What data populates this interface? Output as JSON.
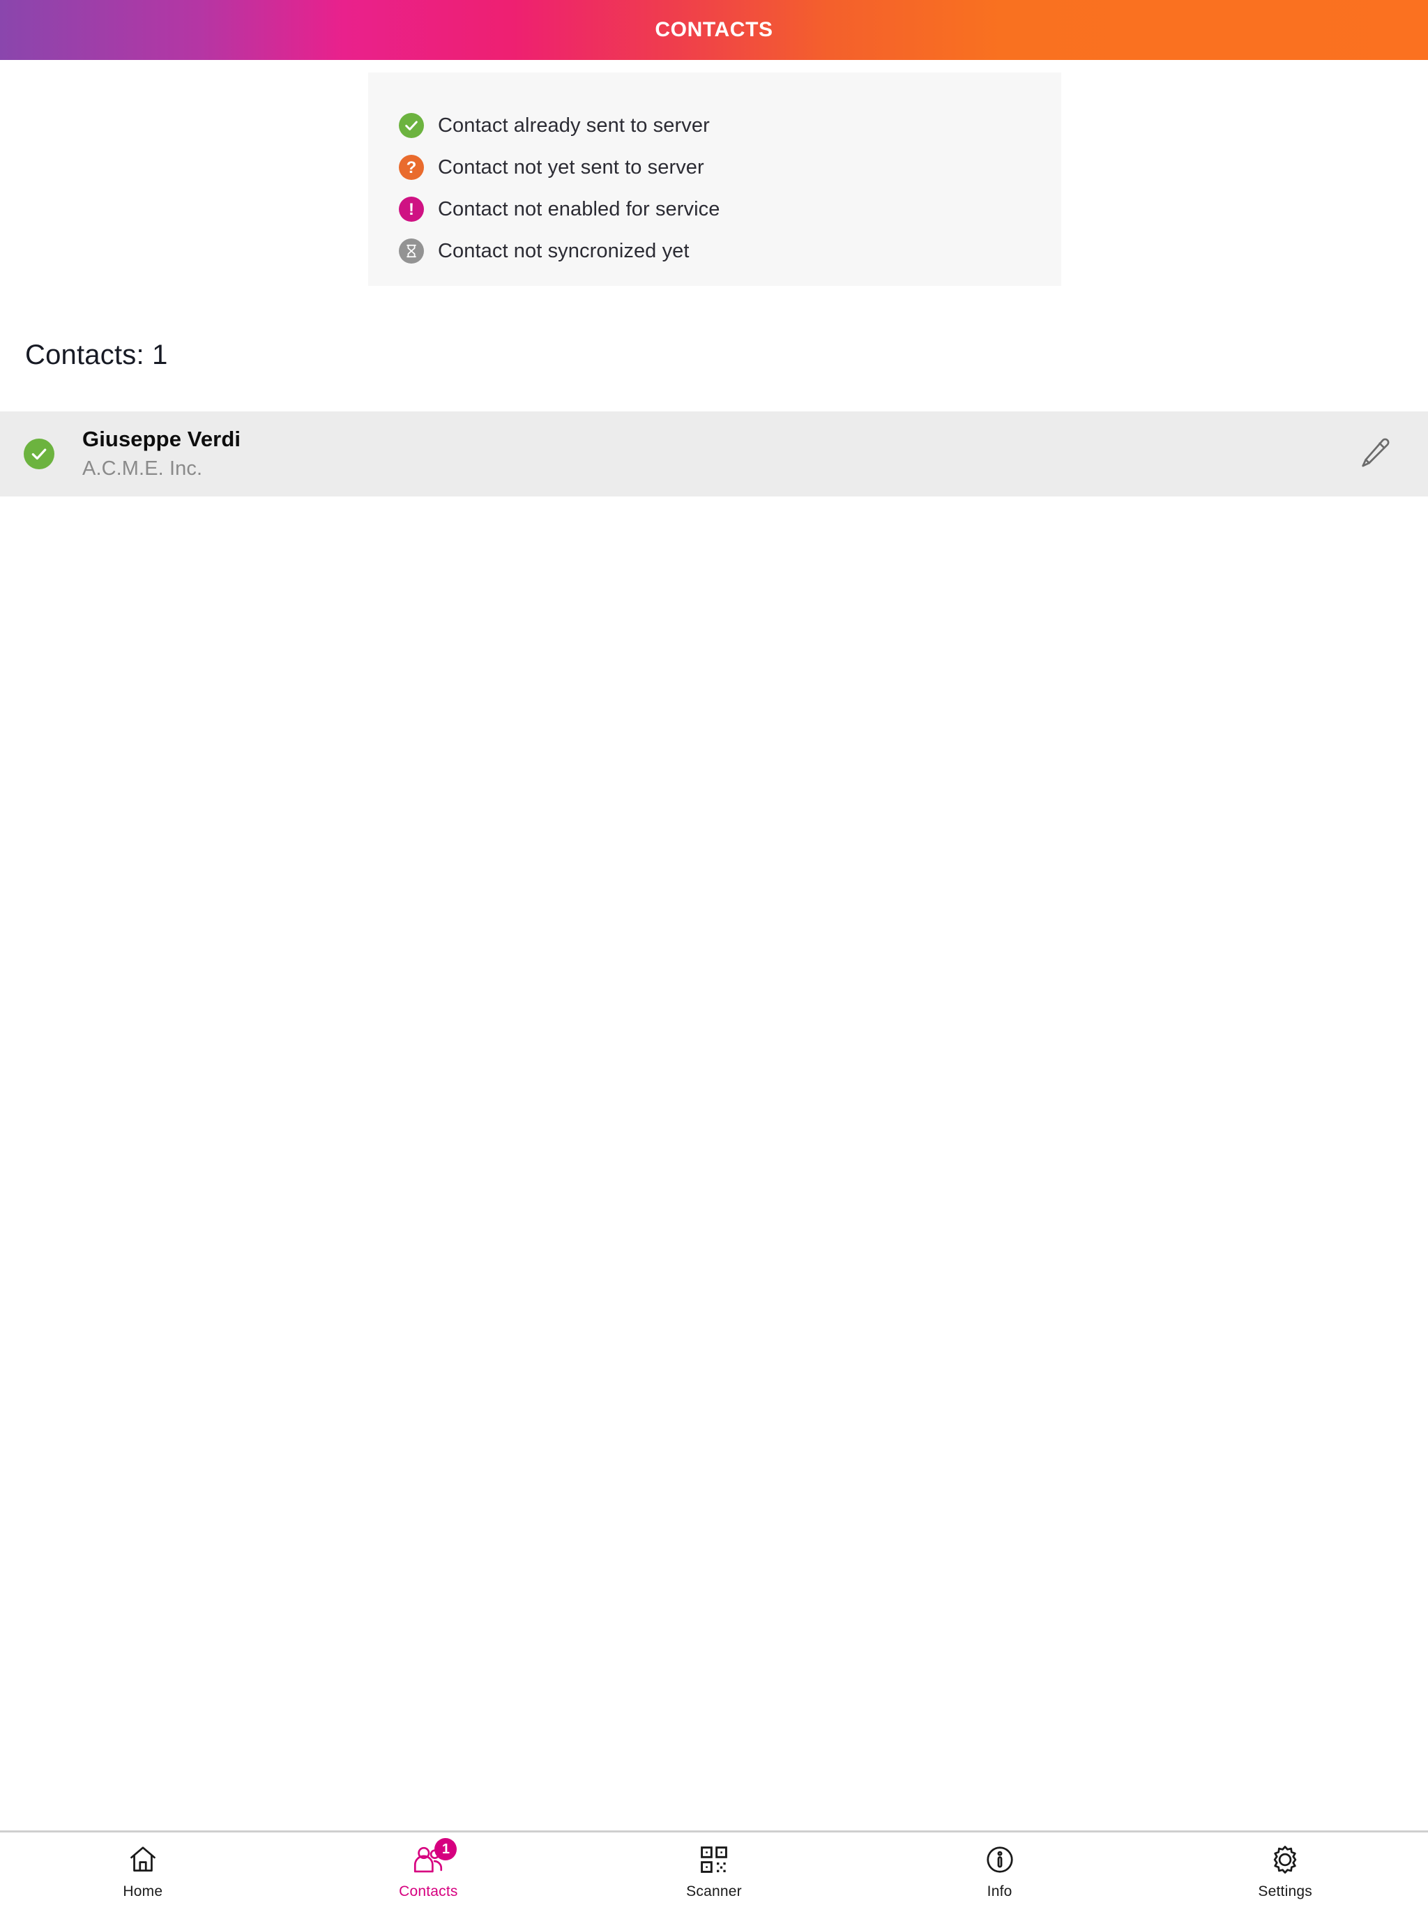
{
  "header": {
    "title": "CONTACTS",
    "gradient_from": "#8a46ad",
    "gradient_mid": "#ee2071",
    "gradient_to": "#fb7120"
  },
  "legend": {
    "items": [
      {
        "label": "Contact already sent to server",
        "icon": "check-circle-icon",
        "color": "#6cb33f"
      },
      {
        "label": "Contact not yet sent to server",
        "icon": "question-circle-icon",
        "color": "#e96b2d"
      },
      {
        "label": "Contact not enabled for service",
        "icon": "exclamation-circle-icon",
        "color": "#cf1283"
      },
      {
        "label": "Contact not syncronized yet",
        "icon": "hourglass-circle-icon",
        "color": "#939393"
      }
    ]
  },
  "contacts_section": {
    "count_label": "Contacts: 1",
    "rows": [
      {
        "name": "Giuseppe Verdi",
        "company": "A.C.M.E. Inc.",
        "status_icon": "check-circle-icon",
        "status_color": "#6cb33f",
        "action_icon": "pencil-edit-icon"
      }
    ]
  },
  "bottom_nav": {
    "active_color": "#d6007f",
    "items": [
      {
        "label": "Home",
        "icon": "home-icon",
        "active": false,
        "badge": ""
      },
      {
        "label": "Contacts",
        "icon": "contacts-icon",
        "active": true,
        "badge": "1"
      },
      {
        "label": "Scanner",
        "icon": "qr-code-icon",
        "active": false,
        "badge": ""
      },
      {
        "label": "Info",
        "icon": "info-icon",
        "active": false,
        "badge": ""
      },
      {
        "label": "Settings",
        "icon": "gear-icon",
        "active": false,
        "badge": ""
      }
    ]
  }
}
